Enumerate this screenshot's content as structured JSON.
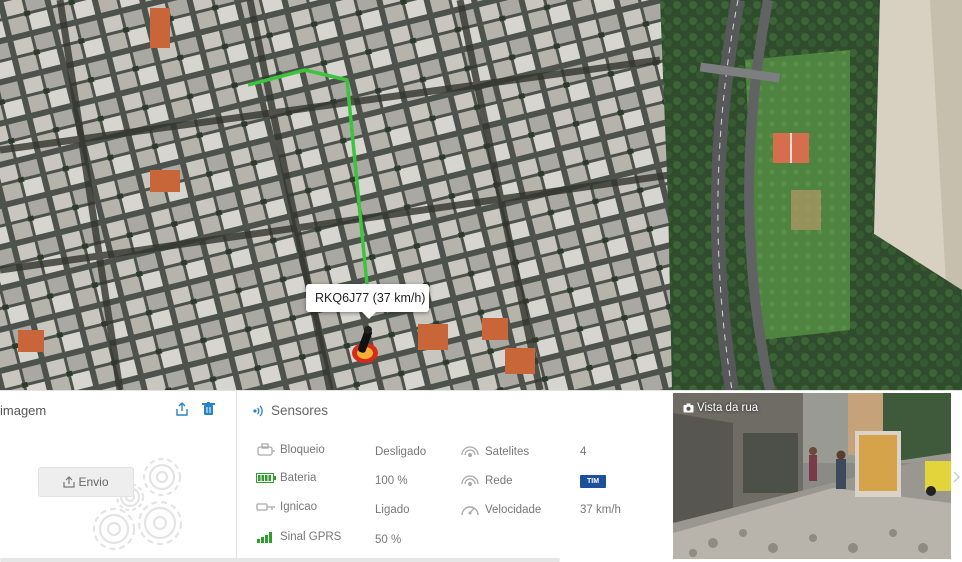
{
  "map": {
    "vehicle_tooltip": "RKQ6J77 (37 km/h)"
  },
  "image_panel": {
    "title": "imagem",
    "envio_button": "Envio"
  },
  "sensors": {
    "title": "Sensores",
    "items": [
      {
        "label": "Bloqueio",
        "value": "Desligado",
        "icon": "lock-icon"
      },
      {
        "label": "Bateria",
        "value": "100 %",
        "icon": "battery-icon"
      },
      {
        "label": "Ignicao",
        "value": "Ligado",
        "icon": "ignition-key-icon"
      },
      {
        "label": "Sinal GPRS",
        "value": "50 %",
        "icon": "signal-bars-icon"
      },
      {
        "label": "Satelites",
        "value": "4",
        "icon": "satellite-signal-icon"
      },
      {
        "label": "Rede",
        "value": "TIM",
        "icon": "network-signal-icon"
      },
      {
        "label": "Velocidade",
        "value": "37 km/h",
        "icon": "speedometer-icon"
      }
    ]
  },
  "street_view": {
    "label": "Vista da rua"
  },
  "colors": {
    "route": "#3cc43c",
    "battery_green": "#2e9e2e",
    "accent_blue": "#2a83c4",
    "tim_blue": "#1e4f9b"
  }
}
